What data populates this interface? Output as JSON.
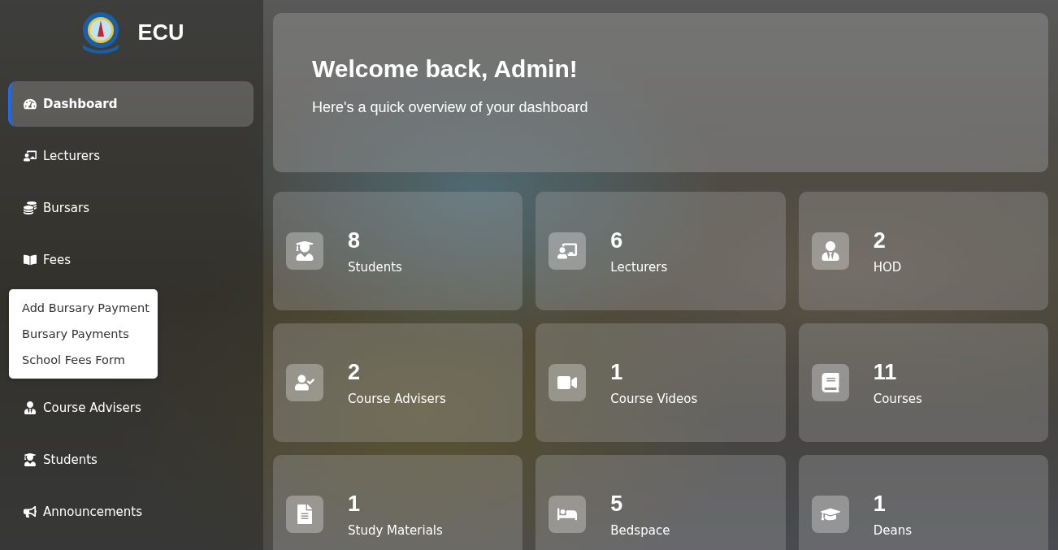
{
  "sidebar": {
    "brand": "ECU",
    "items": [
      {
        "label": "Dashboard",
        "selected": true
      },
      {
        "label": "Lecturers",
        "selected": false
      },
      {
        "label": "Bursars",
        "selected": false
      },
      {
        "label": "Fees",
        "selected": false,
        "submenu": [
          "Add Bursary Payment",
          "Bursary Payments",
          "School Fees Form"
        ]
      },
      {
        "label": "Course Advisers",
        "selected": false
      },
      {
        "label": "Students",
        "selected": false
      },
      {
        "label": "Announcements",
        "selected": false
      }
    ]
  },
  "welcome": {
    "title": "Welcome back, Admin!",
    "subtitle": "Here's a quick overview of your dashboard"
  },
  "stats": [
    {
      "count": "8",
      "label": "Students"
    },
    {
      "count": "6",
      "label": "Lecturers"
    },
    {
      "count": "2",
      "label": "HOD"
    },
    {
      "count": "2",
      "label": "Course Advisers"
    },
    {
      "count": "1",
      "label": "Course Videos"
    },
    {
      "count": "11",
      "label": "Courses"
    },
    {
      "count": "1",
      "label": "Study Materials"
    },
    {
      "count": "5",
      "label": "Bedspace"
    },
    {
      "count": "1",
      "label": "Deans"
    }
  ]
}
